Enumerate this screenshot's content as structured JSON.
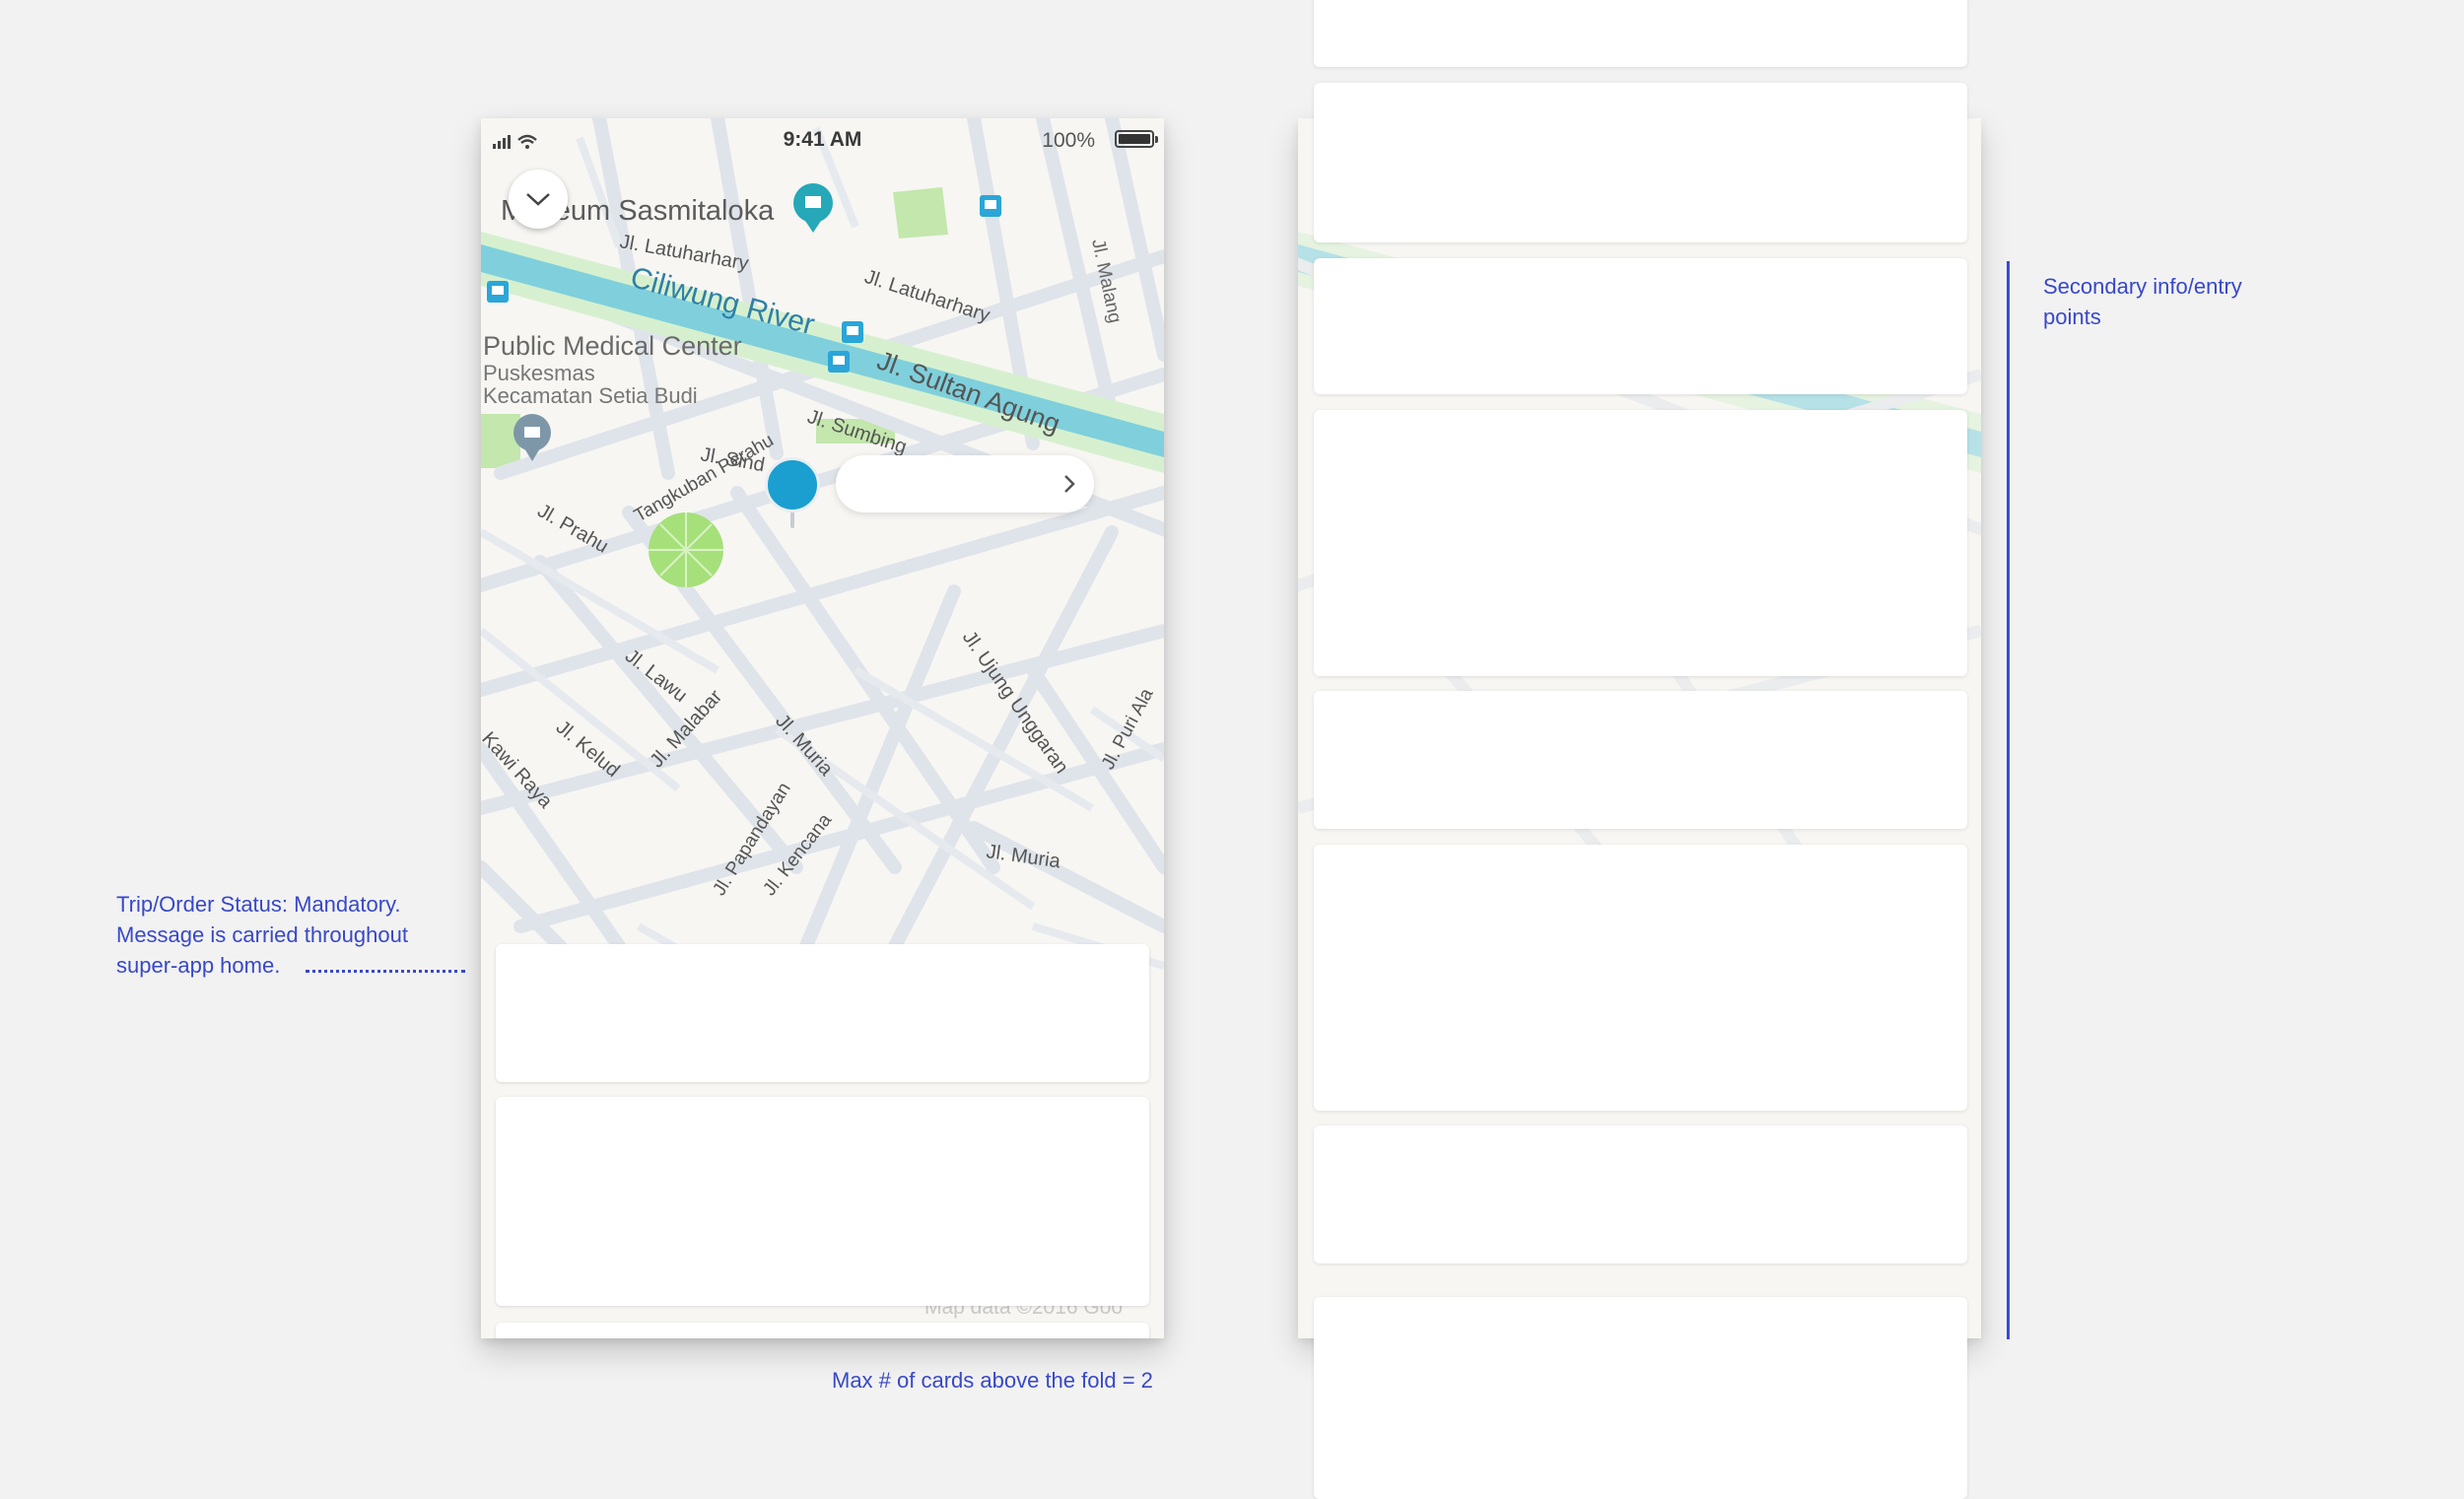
{
  "status_bar": {
    "time": "9:41 AM",
    "battery_text": "100%"
  },
  "map": {
    "labels": {
      "museum": "Museum Sasmitaloka",
      "river": "Ciliwung River",
      "medical_center": "Public Medical Center",
      "puskesmas_line1": "Puskesmas",
      "puskesmas_line2": "Kecamatan Setia Budi",
      "latuharhary_1": "Jl. Latuharhary",
      "latuharhary_2": "Jl. Latuharhary",
      "malang": "Jl. Malang",
      "sultan_agung": "Jl. Sultan Agung",
      "sumbing": "Jl. Sumbing",
      "sindoro": "Jl. Sind",
      "prahu": "Jl. Prahu",
      "tangkuban_perahu": "Tangkuban Perahu",
      "lawu": "Jl. Lawu",
      "malabar": "Jl. Malabar",
      "kelud": "Jl. Kelud",
      "kawi_raya": "Kawi Raya",
      "muria_1": "Jl. Muria",
      "muria_2": "Jl. Muria",
      "papandayan": "Jl. Papandayan",
      "kencana": "Jl. Kencana",
      "ujung_unggaran": "Jl. Ujung Unggaran",
      "puri_alam": "Jl. Puri Ala",
      "map_data": "Map data ©2016 Goo"
    }
  },
  "colors": {
    "accent_annotation": "#3848c8",
    "pin": "#1a9fd0",
    "river": "#7fd0dc",
    "park": "#bfe7a8"
  },
  "icons": {
    "collapse": "chevron-down-icon",
    "pill_action": "chevron-right-icon",
    "museum_marker": "museum-pin-icon",
    "bus_stop": "bus-stop-icon"
  },
  "annotations": {
    "trip_status_line1": "Trip/Order Status: Mandatory.",
    "trip_status_line2": "Message is carried throughout",
    "trip_status_line3": "super-app home.",
    "max_cards": "Max # of cards above the fold = 2",
    "secondary_line1": "Secondary info/entry",
    "secondary_line2": "points"
  }
}
